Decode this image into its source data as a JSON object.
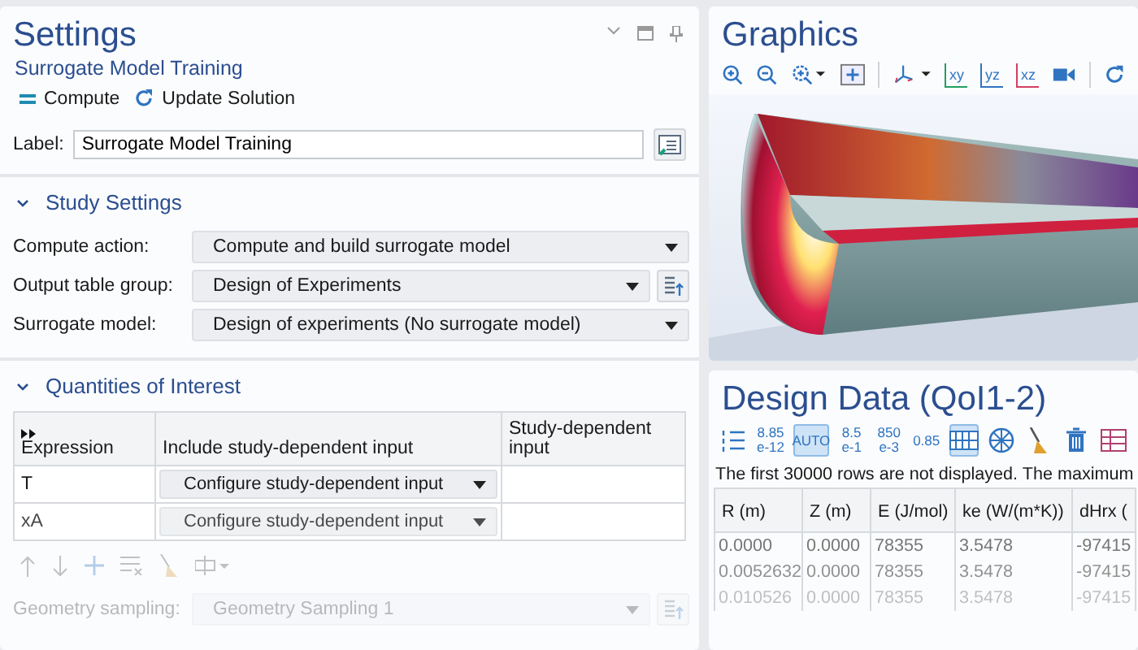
{
  "settings": {
    "title": "Settings",
    "subtitle": "Surrogate Model Training",
    "actions": [
      {
        "kind": "compute",
        "label": "Compute"
      },
      {
        "kind": "update",
        "label": "Update Solution"
      }
    ],
    "label_field": {
      "label": "Label:",
      "value": "Surrogate Model Training"
    },
    "study_settings": {
      "title": "Study Settings",
      "expanded": true,
      "rows": [
        {
          "label": "Compute action:",
          "value": "Compute and build surrogate model",
          "has_button": false
        },
        {
          "label": "Output table group:",
          "value": "Design of Experiments",
          "has_button": true
        },
        {
          "label": "Surrogate model:",
          "value": "Design of experiments (No surrogate model)",
          "has_button": false
        }
      ]
    },
    "quantities": {
      "title": "Quantities of Interest",
      "expanded": true,
      "columns": [
        "Expression",
        "Include study-dependent input",
        "Study-dependent input"
      ],
      "rows": [
        {
          "expression": "T",
          "input": "Configure study-dependent input"
        },
        {
          "expression": "xA",
          "input": "Configure study-dependent input"
        }
      ],
      "geometry": {
        "label": "Geometry sampling:",
        "value": "Geometry Sampling 1",
        "disabled": true
      }
    }
  },
  "graphics": {
    "title": "Graphics",
    "view_buttons": [
      {
        "kind": "xy",
        "label": "xy"
      },
      {
        "kind": "yz",
        "label": "yz"
      },
      {
        "kind": "xz",
        "label": "xz"
      }
    ]
  },
  "design_data": {
    "title": "Design Data (QoI1-2)",
    "toolbar": [
      {
        "kind": "list",
        "selected": false
      },
      {
        "kind": "number",
        "label": "8.85",
        "sub": "e-12",
        "selected": false
      },
      {
        "kind": "number",
        "label": "AUTO",
        "selected": true
      },
      {
        "kind": "number",
        "label": "8.5",
        "sub": "e-1",
        "selected": false
      },
      {
        "kind": "number",
        "label": "850",
        "sub": "e-3",
        "selected": false
      },
      {
        "kind": "number",
        "label": "0.85",
        "selected": false
      },
      {
        "kind": "grid",
        "selected": true
      },
      {
        "kind": "globe",
        "selected": false
      },
      {
        "kind": "broom",
        "selected": false
      },
      {
        "kind": "trash",
        "selected": false
      },
      {
        "kind": "table",
        "selected": false
      }
    ],
    "notice": "The first 30000 rows are not displayed. The maximum",
    "columns": [
      "R (m)",
      "Z (m)",
      "E (J/mol)",
      "ke (W/(m*K))",
      "dHrx ("
    ],
    "rows": [
      [
        "0.0000",
        "0.0000",
        "78355",
        "3.5478",
        "-97415"
      ],
      [
        "0.0052632",
        "0.0000",
        "78355",
        "3.5478",
        "-97415"
      ],
      [
        "0.010526",
        "0.0000",
        "78355",
        "3.5478",
        "-97415"
      ]
    ]
  }
}
